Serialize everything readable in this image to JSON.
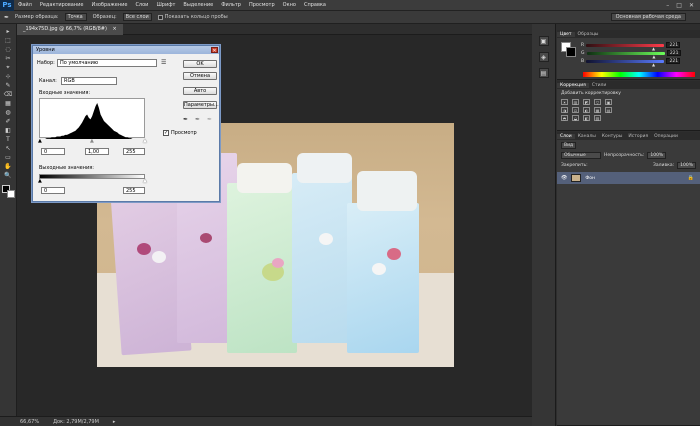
{
  "app": {
    "logo": "Ps"
  },
  "menu": [
    "Файл",
    "Редактирование",
    "Изображение",
    "Слои",
    "Шрифт",
    "Выделение",
    "Фильтр",
    "Просмотр",
    "Окно",
    "Справка"
  ],
  "window_controls": [
    "–",
    "□",
    "✕"
  ],
  "options": {
    "sample_size_label": "Размер образца:",
    "sample_size_value": "Точка",
    "sample_label": "Образец:",
    "sample_value": "Все слои",
    "show_ring_label": "Показать кольцо пробы",
    "workspace_button": "Основная рабочая среда"
  },
  "document": {
    "tab_title": "_194x75D.jpg @ 66,7% (RGB/8#)",
    "tab_close": "×"
  },
  "status": {
    "zoom": "66,67%",
    "doc_info": "Док: 2,79M/2,79M"
  },
  "tools": [
    "▸",
    "⬚",
    "◌",
    "✂",
    "⌖",
    "⊹",
    "✎",
    "⌫",
    "▦",
    "◍",
    "✐",
    "◧",
    "T",
    "↖",
    "▭",
    "✋",
    "🔍"
  ],
  "panels": {
    "color_tabs": [
      "Цвет",
      "Образцы"
    ],
    "color_sliders": [
      {
        "label": "R",
        "value": "221",
        "gradient": "linear-gradient(90deg,#2f0f12,#ff3b4a)",
        "pos": 0.87
      },
      {
        "label": "G",
        "value": "221",
        "gradient": "linear-gradient(90deg,#0f2f12,#6cff5a)",
        "pos": 0.87
      },
      {
        "label": "B",
        "value": "221",
        "gradient": "linear-gradient(90deg,#10122f,#5a7bff)",
        "pos": 0.87
      }
    ],
    "spectrum": "linear-gradient(90deg,#f00,#ff0,#0f0,#0ff,#00f,#f0f,#f00)",
    "adjust_tabs": [
      "Коррекция",
      "Стили"
    ],
    "adjust_title": "Добавить корректировку",
    "adjust_icons_row1": [
      "☀",
      "▥",
      "◩",
      "▽",
      "▣"
    ],
    "adjust_icons_row2": [
      "◑",
      "⚖",
      "◐",
      "▦",
      "▤"
    ],
    "adjust_icons_row3": [
      "◓",
      "◒",
      "◧",
      "▨"
    ],
    "layers_tabs": [
      "Слои",
      "Каналы",
      "Контуры",
      "История",
      "Операции"
    ],
    "kind_label": "Вид",
    "blend_mode": "Обычные",
    "opacity_label": "Непрозрачность:",
    "opacity_value": "100%",
    "lock_label": "Закрепить:",
    "fill_label": "Заливка:",
    "fill_value": "100%",
    "layer_name": "Фон",
    "layer_lock": "🔒"
  },
  "strip_icons": [
    "▣",
    "◈",
    "▤"
  ],
  "levels_dialog": {
    "title": "Уровни",
    "close": "✕",
    "preset_label": "Набор:",
    "preset_value": "По умолчанию",
    "channel_label": "Канал:",
    "channel_value": "RGB",
    "input_label": "Входные значения:",
    "input_values": [
      "0",
      "1,00",
      "255"
    ],
    "output_label": "Выходные значения:",
    "output_values": [
      "0",
      "255"
    ],
    "buttons": [
      "OK",
      "Отмена",
      "Авто",
      "Параметры..."
    ],
    "preview_label": "Просмотр",
    "preview_checked": "✓",
    "eyedroppers": [
      "✒",
      "✒",
      "✒"
    ]
  },
  "histogram": [
    0,
    0,
    0,
    0,
    1,
    1,
    1,
    2,
    2,
    2,
    3,
    3,
    3,
    4,
    4,
    5,
    5,
    6,
    7,
    8,
    9,
    10,
    12,
    14,
    17,
    20,
    24,
    28,
    30,
    26,
    24,
    28,
    34,
    40,
    44,
    38,
    30,
    26,
    22,
    20,
    18,
    16,
    14,
    12,
    10,
    9,
    8,
    6,
    5,
    4,
    3,
    2,
    2,
    1,
    1,
    0,
    0,
    0,
    0,
    0,
    0,
    0,
    0,
    0
  ]
}
